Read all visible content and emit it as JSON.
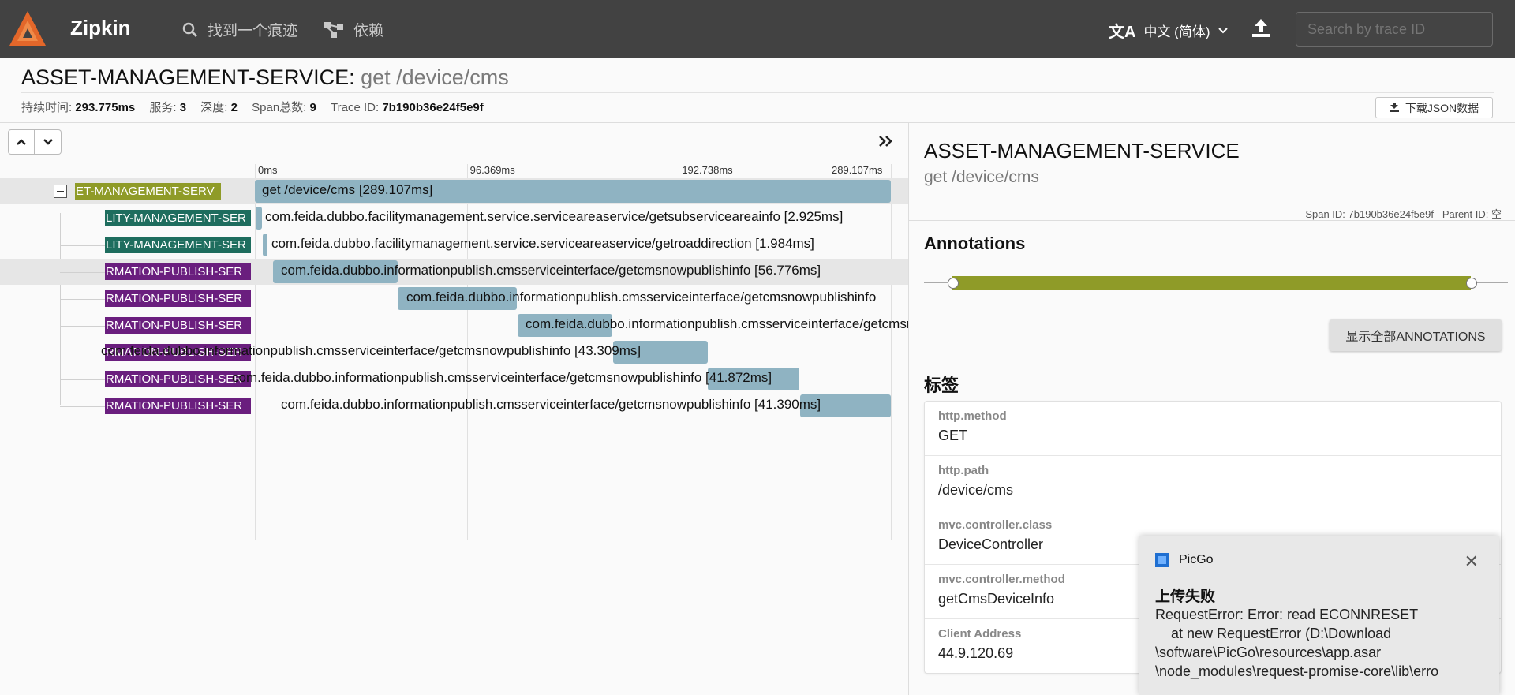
{
  "app": {
    "name": "Zipkin"
  },
  "nav": {
    "find_trace": "找到一个痕迹",
    "dependencies": "依赖"
  },
  "language": {
    "label": "中文 (简体)"
  },
  "search": {
    "placeholder": "Search by trace ID"
  },
  "trace": {
    "service": "ASSET-MANAGEMENT-SERVICE",
    "separator": ":",
    "operation": "get /device/cms",
    "stats": [
      {
        "label": "持续时间:",
        "value": "293.775ms"
      },
      {
        "label": "服务:",
        "value": "3"
      },
      {
        "label": "深度:",
        "value": "2"
      },
      {
        "label": "Span总数:",
        "value": "9"
      },
      {
        "label": "Trace ID:",
        "value": "7b190b36e24f5e9f"
      }
    ],
    "download_label": "下载JSON数据"
  },
  "timeline": {
    "ticks": [
      "0ms",
      "96.369ms",
      "192.738ms",
      "289.107ms"
    ],
    "total_ms": 289.107,
    "spans": [
      {
        "service_label": "ET-MANAGEMENT-SERV",
        "service_kind": "svc",
        "label": "get /device/cms [289.107ms]",
        "start_ms": 0,
        "duration_ms": 289.107,
        "selected": true
      },
      {
        "service_label": "LITY-MANAGEMENT-SER",
        "service_kind": "fac",
        "label": "com.feida.dubbo.facilitymanagement.service.serviceareaservice/getsubserviceareainfo [2.925ms]",
        "start_ms": 0.4,
        "duration_ms": 2.925,
        "selected": false
      },
      {
        "service_label": "LITY-MANAGEMENT-SER",
        "service_kind": "fac",
        "label": "com.feida.dubbo.facilitymanagement.service.serviceareaservice/getroaddirection [1.984ms]",
        "start_ms": 3.6,
        "duration_ms": 1.984,
        "selected": false
      },
      {
        "service_label": "RMATION-PUBLISH-SER",
        "service_kind": "inf",
        "label": "com.feida.dubbo.informationpublish.cmsserviceinterface/getcmsnowpublishinfo [56.776ms]",
        "start_ms": 8.2,
        "duration_ms": 56.776,
        "selected": true
      },
      {
        "service_label": "RMATION-PUBLISH-SER",
        "service_kind": "inf",
        "label": "com.feida.dubbo.informationpublish.cmsserviceinterface/getcmsnowpublishinfo",
        "start_ms": 65.0,
        "duration_ms": 54.0,
        "selected": false
      },
      {
        "service_label": "RMATION-PUBLISH-SER",
        "service_kind": "inf",
        "label": "com.feida.dubbo.informationpublish.cmsserviceinterface/getcmsnowpublishinfo",
        "start_ms": 119.5,
        "duration_ms": 43.0,
        "selected": false
      },
      {
        "service_label": "RMATION-PUBLISH-SER",
        "service_kind": "inf",
        "label": "com.feida.dubbo.informationpublish.cmsserviceinterface/getcmsnowpublishinfo [43.309ms]",
        "start_ms": 162.7,
        "duration_ms": 43.309,
        "selected": false
      },
      {
        "service_label": "RMATION-PUBLISH-SER",
        "service_kind": "inf",
        "label": "com.feida.dubbo.informationpublish.cmsserviceinterface/getcmsnowpublishinfo [41.872ms]",
        "start_ms": 205.8,
        "duration_ms": 41.872,
        "selected": false
      },
      {
        "service_label": "RMATION-PUBLISH-SER",
        "service_kind": "inf",
        "label": "com.feida.dubbo.informationpublish.cmsserviceinterface/getcmsnowpublishinfo [41.390ms]",
        "start_ms": 247.7,
        "duration_ms": 41.39,
        "selected": false
      }
    ]
  },
  "detail": {
    "service": "ASSET-MANAGEMENT-SERVICE",
    "operation": "get /device/cms",
    "span_id_label": "Span ID:",
    "span_id": "7b190b36e24f5e9f",
    "parent_id_label": "Parent ID:",
    "parent_id": "空",
    "annotations_title": "Annotations",
    "show_all_label": "显示全部ANNOTATIONS",
    "tags_title": "标签",
    "tags": [
      {
        "key": "http.method",
        "value": "GET"
      },
      {
        "key": "http.path",
        "value": "/device/cms"
      },
      {
        "key": "mvc.controller.class",
        "value": "DeviceController"
      },
      {
        "key": "mvc.controller.method",
        "value": "getCmsDeviceInfo"
      },
      {
        "key": "Client Address",
        "value": "44.9.120.69"
      }
    ]
  },
  "toast": {
    "app": "PicGo",
    "title": "上传失败",
    "message": "RequestError: Error: read ECONNRESET\n    at new RequestError (D:\\Download\n\\software\\PicGo\\resources\\app.asar\n\\node_modules\\request-promise-core\\lib\\erro"
  },
  "colors": {
    "topbar": "#424242",
    "svc_asset": "#8f9b28",
    "svc_facility": "#1e6d5e",
    "svc_info": "#6a1e7e",
    "span_bar": "#8fb3c2",
    "logo": "#e3672a"
  }
}
